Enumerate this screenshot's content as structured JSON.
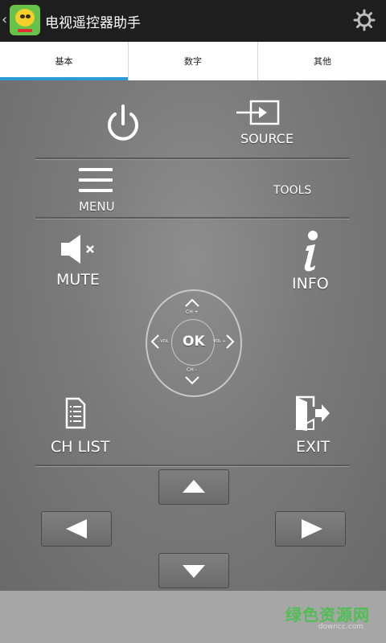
{
  "appbar": {
    "title": "电视遥控器助手",
    "back_glyph": "‹",
    "icon": "app-logo-icon",
    "settings_icon": "gear-icon"
  },
  "tabs": [
    {
      "label": "基本",
      "selected": true
    },
    {
      "label": "数字",
      "selected": false
    },
    {
      "label": "其他",
      "selected": false
    }
  ],
  "colors": {
    "appbar": "#1e1e1e",
    "tab_indicator": "#2b9bd6",
    "remote_bg": "#7a7a7a",
    "footer": "#a6a6a6",
    "watermark": "#4fbf53"
  },
  "remote": {
    "power": {
      "icon": "power-icon"
    },
    "source": {
      "label": "SOURCE",
      "icon": "source-input-icon"
    },
    "menu": {
      "label": "MENU",
      "icon": "menu-icon"
    },
    "tools": {
      "label": "TOOLS"
    },
    "mute": {
      "label": "MUTE",
      "icon": "speaker-mute-icon"
    },
    "info": {
      "label": "INFO",
      "icon": "info-icon"
    },
    "nav_ring": {
      "ok": "OK",
      "ch_up": "CH +",
      "ch_down": "CH -",
      "vol_down": "- VOL",
      "vol_up": "VOL +"
    },
    "ch_list": {
      "label": "CH LIST",
      "icon": "document-list-icon"
    },
    "exit": {
      "label": "EXIT",
      "icon": "exit-door-icon"
    },
    "dpad": {
      "up": "up-arrow-icon",
      "left": "left-arrow-icon",
      "right": "right-arrow-icon",
      "down": "down-arrow-icon"
    }
  },
  "footer": {
    "watermark": "绿色资源网",
    "watermark_url": "downcc.com"
  }
}
